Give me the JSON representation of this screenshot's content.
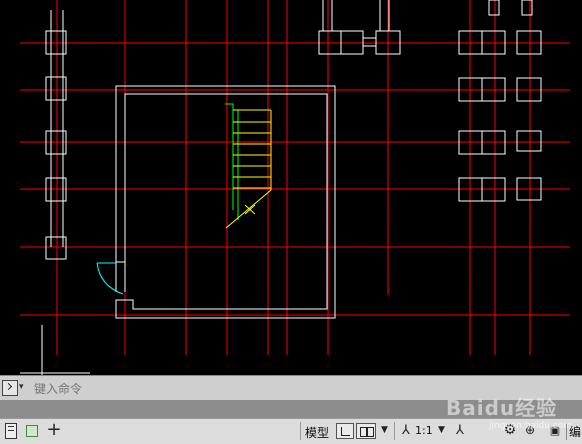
{
  "command_line": {
    "placeholder": "键入命令"
  },
  "status_bar": {
    "model_label": "模型",
    "scale_value": "1:1",
    "edit_label": "编"
  },
  "watermark": {
    "brand": "Baidu经验",
    "sub": "jingyan.baidu.com"
  },
  "colors": {
    "background": "#000000",
    "grid_lines": "#ff0000",
    "outlines": "#ffffff",
    "stair_green": "#00ff00",
    "stair_yellow": "#ffff00",
    "door_cyan": "#00ffff"
  }
}
